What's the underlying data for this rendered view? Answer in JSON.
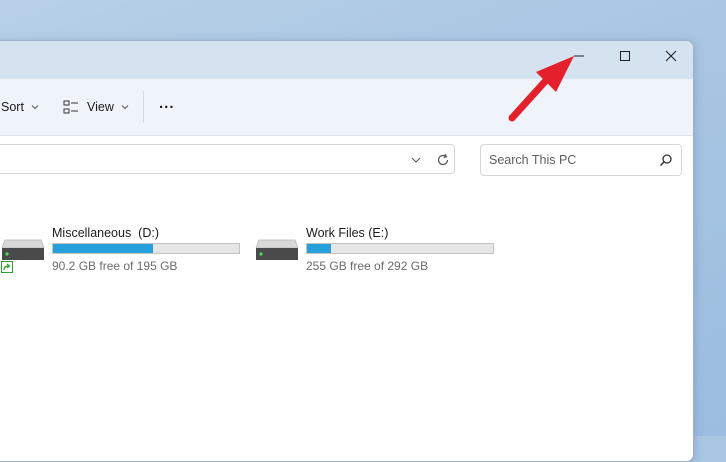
{
  "toolbar": {
    "sort_label": "Sort",
    "view_label": "View",
    "more_label": "..."
  },
  "search": {
    "placeholder": "Search This PC"
  },
  "drives": [
    {
      "name": "Miscellaneous  (D:)",
      "free_text": "90.2 GB free of 195 GB",
      "used_fraction": 0.54
    },
    {
      "name": "Work Files (E:)",
      "free_text": "255 GB free of 292 GB",
      "used_fraction": 0.13
    }
  ],
  "colors": {
    "accent": "#26a0da",
    "annotation_arrow": "#e3202b"
  }
}
